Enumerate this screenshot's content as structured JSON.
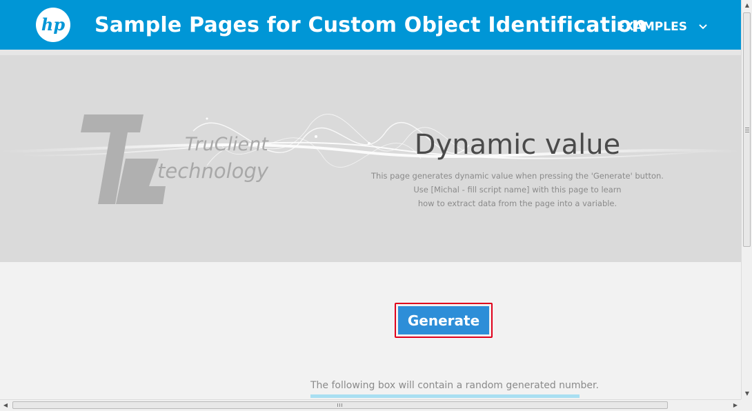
{
  "header": {
    "title": "Sample Pages for Custom Object Identification",
    "nav_label": "EXAMPLES",
    "logo_icon": "hp-logo-icon",
    "color": "#0096d6"
  },
  "hero": {
    "logo_line1": "TruClient",
    "logo_line2": "technology",
    "title": "Dynamic value",
    "description": [
      "This page generates dynamic value when pressing the 'Generate' button.",
      "Use [Michal - fill script name] with this page to learn",
      "how to extract data from the page into a variable."
    ]
  },
  "main": {
    "generate_label": "Generate",
    "info_text": "The following box will contain a random generated number."
  },
  "colors": {
    "button": "#2d8ed8",
    "highlight_border": "#e0001b",
    "info_underline": "#a9dff2"
  }
}
